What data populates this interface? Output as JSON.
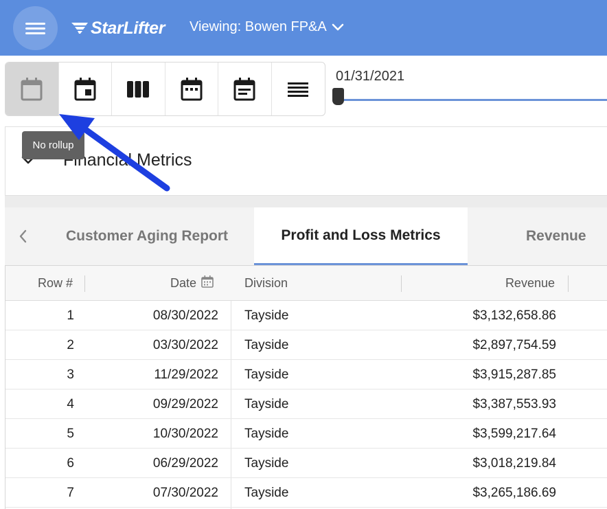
{
  "header": {
    "brand_name": "StarLifter",
    "viewing_label": "Viewing: Bowen FP&A",
    "menu_icon": "hamburger-menu-icon",
    "viewing_dropdown_icon": "chevron-down-icon"
  },
  "toolbar": {
    "buttons": [
      {
        "icon": "calendar-blank-icon",
        "active": true
      },
      {
        "icon": "calendar-day-icon",
        "active": false
      },
      {
        "icon": "columns-icon",
        "active": false
      },
      {
        "icon": "calendar-month-icon",
        "active": false
      },
      {
        "icon": "calendar-list-icon",
        "active": false
      },
      {
        "icon": "rows-lines-icon",
        "active": false
      }
    ],
    "tooltip": "No rollup"
  },
  "slider": {
    "date": "01/31/2021",
    "position_fraction": 0.0
  },
  "section": {
    "title": "Financial Metrics",
    "toggle_icon": "chevron-down-icon"
  },
  "tabs": {
    "prev_icon": "chevron-left-icon",
    "items": [
      {
        "label": "Customer Aging Report",
        "active": false
      },
      {
        "label": "Profit and Loss Metrics",
        "active": true
      },
      {
        "label": "Revenue",
        "active": false
      }
    ]
  },
  "table": {
    "columns": [
      "Row #",
      "Date",
      "Division",
      "Revenue"
    ],
    "date_column_icon": "calendar-icon",
    "rows": [
      {
        "row": "1",
        "date": "08/30/2022",
        "division": "Tayside",
        "revenue": "$3,132,658.86"
      },
      {
        "row": "2",
        "date": "03/30/2022",
        "division": "Tayside",
        "revenue": "$2,897,754.59"
      },
      {
        "row": "3",
        "date": "11/29/2022",
        "division": "Tayside",
        "revenue": "$3,915,287.85"
      },
      {
        "row": "4",
        "date": "09/29/2022",
        "division": "Tayside",
        "revenue": "$3,387,553.93"
      },
      {
        "row": "5",
        "date": "10/30/2022",
        "division": "Tayside",
        "revenue": "$3,599,217.64"
      },
      {
        "row": "6",
        "date": "06/29/2022",
        "division": "Tayside",
        "revenue": "$3,018,219.84"
      },
      {
        "row": "7",
        "date": "07/30/2022",
        "division": "Tayside",
        "revenue": "$3,265,186.69"
      }
    ]
  },
  "colors": {
    "header_bg": "#5b8dde",
    "accent": "#6b93d8",
    "annotation_arrow": "#1d3fe0"
  }
}
